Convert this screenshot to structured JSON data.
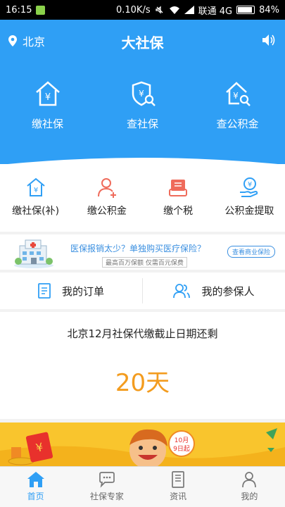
{
  "status_bar": {
    "time": "16:15",
    "speed": "0.10K/s",
    "carrier": "联通 4G",
    "battery": "84%"
  },
  "header": {
    "location": "北京",
    "title": "大社保"
  },
  "main_actions": [
    {
      "label": "缴社保",
      "icon": "house-yuan-icon"
    },
    {
      "label": "查社保",
      "icon": "shield-search-icon"
    },
    {
      "label": "查公积金",
      "icon": "house-search-icon"
    }
  ],
  "quick_actions": [
    {
      "label": "缴社保(补)",
      "icon": "house-yuan-icon"
    },
    {
      "label": "缴公积金",
      "icon": "person-add-icon"
    },
    {
      "label": "缴个税",
      "icon": "tax-receipt-icon"
    },
    {
      "label": "公积金提取",
      "icon": "hand-coin-icon"
    }
  ],
  "banner": {
    "text": "医保报销太少？单独购买医疗保险？",
    "sub": "最高百万保额 仅需百元保费",
    "cta": "查看商业保险"
  },
  "orders": {
    "my_orders": "我的订单",
    "my_insured": "我的参保人"
  },
  "deadline": {
    "message": "北京12月社保代缴截止日期还剩",
    "days": "20天"
  },
  "promo": {
    "date_line1": "10月",
    "date_line2": "9日起"
  },
  "tabs": [
    {
      "label": "首页",
      "active": true
    },
    {
      "label": "社保专家",
      "active": false
    },
    {
      "label": "资讯",
      "active": false
    },
    {
      "label": "我的",
      "active": false
    }
  ],
  "colors": {
    "primary": "#2f9ff5",
    "accent": "#f39c1f",
    "promo": "#f9c52d"
  }
}
